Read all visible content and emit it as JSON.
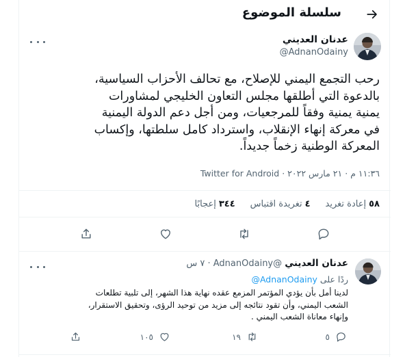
{
  "header": {
    "title": "سلسلة الموضوع",
    "back_icon": "arrow-back-icon"
  },
  "main_tweet": {
    "author_name": "عدنان العديني",
    "author_handle": "@AdnanOdainy",
    "text": "رحب التجمع اليمني للإصلاح، مع تحالف الأحزاب السياسية،\nبالدعوة التي أطلقها مجلس التعاون الخليجي لمشاورات\nيمنية يمنية وفقاً للمرجعيات، ومن أجل دعم الدولة اليمنية\nفي معركة إنهاء الإنقلاب، واسترداد كامل سلطتها، وإكساب\nالمعركة الوطنية زخماً جديداً.",
    "time": "١١:٣٦ م",
    "date": "٢١ مارس ٢٠٢٢",
    "source": "Twitter for Android",
    "stats": {
      "retweets_count": "٥٨",
      "retweets_label": "إعادة تغريد",
      "quotes_count": "٤",
      "quotes_label": "تغريدة اقتباس",
      "likes_count": "٣٤٤",
      "likes_label": "إعجابًا"
    }
  },
  "reply_tweet": {
    "author_name": "عدنان العديني",
    "author_handle": "@AdnanOdainy",
    "time": "٧ س",
    "reply_label": "ردًا على",
    "reply_mention": "@AdnanOdainy",
    "text": "لدينا أمل بأن يؤدي المؤتمر المزمع عقده نهاية هذا الشهر، إلى تلبية تطلعات\nالشعب اليمني، وأن تقود نتائجه إلى مزيد من توحيد الرؤى، وتحقيق الاستقرار،\nوإنهاء معاناة الشعب اليمني .",
    "replies_count": "٥",
    "retweets_count": "١٩",
    "likes_count": "١٠٥"
  },
  "colors": {
    "accent": "#1d9bf0",
    "secondary_text": "#536471",
    "border": "#eff3f4"
  }
}
